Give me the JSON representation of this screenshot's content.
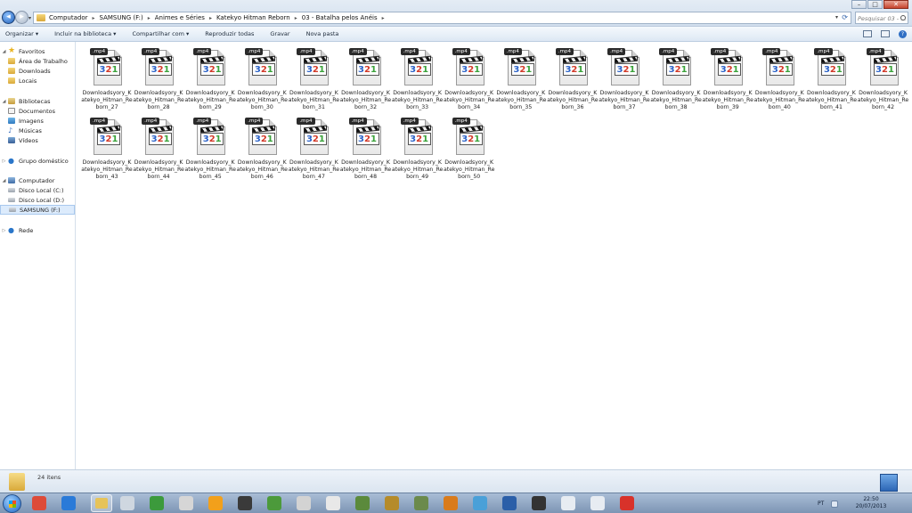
{
  "window": {
    "minimize": "–",
    "maximize": "□",
    "close": "✕"
  },
  "address": {
    "crumbs": [
      "Computador",
      "SAMSUNG (F:)",
      "Animes e Séries",
      "Katekyo Hitman Reborn",
      "03 - Batalha pelos Anéis"
    ],
    "separator": "▸"
  },
  "search": {
    "placeholder": "Pesquisar 03 - ..."
  },
  "toolbar": {
    "items": [
      "Organizar ▾",
      "Incluir na biblioteca ▾",
      "Compartilhar com ▾",
      "Reproduzir todas",
      "Gravar",
      "Nova pasta"
    ]
  },
  "sidebar": {
    "favorites_label": "Favoritos",
    "favorites": [
      "Área de Trabalho",
      "Downloads",
      "Locais"
    ],
    "libraries_label": "Bibliotecas",
    "libraries": [
      "Documentos",
      "Imagens",
      "Músicas",
      "Vídeos"
    ],
    "homegroup_label": "Grupo doméstico",
    "computer_label": "Computador",
    "drives": [
      "Disco Local (C:)",
      "Disco Local (D:)",
      "SAMSUNG (F:)"
    ],
    "network_label": "Rede"
  },
  "files": {
    "ext": ".mp4",
    "badge": [
      "3",
      "2",
      "1"
    ],
    "items": [
      "Downloadsyory_Katekyo_Hitman_Reborn_27",
      "Downloadsyory_Katekyo_Hitman_Reborn_28",
      "Downloadsyory_Katekyo_Hitman_Reborn_29",
      "Downloadsyory_Katekyo_Hitman_Reborn_30",
      "Downloadsyory_Katekyo_Hitman_Reborn_31",
      "Downloadsyory_Katekyo_Hitman_Reborn_32",
      "Downloadsyory_Katekyo_Hitman_Reborn_33",
      "Downloadsyory_Katekyo_Hitman_Reborn_34",
      "Downloadsyory_Katekyo_Hitman_Reborn_35",
      "Downloadsyory_Katekyo_Hitman_Reborn_36",
      "Downloadsyory_Katekyo_Hitman_Reborn_37",
      "Downloadsyory_Katekyo_Hitman_Reborn_38",
      "Downloadsyory_Katekyo_Hitman_Reborn_39",
      "Downloadsyory_Katekyo_Hitman_Reborn_40",
      "Downloadsyory_Katekyo_Hitman_Reborn_41",
      "Downloadsyory_Katekyo_Hitman_Reborn_42",
      "Downloadsyory_Katekyo_Hitman_Reborn_43",
      "Downloadsyory_Katekyo_Hitman_Reborn_44",
      "Downloadsyory_Katekyo_Hitman_Reborn_45",
      "Downloadsyory_Katekyo_Hitman_Reborn_46",
      "Downloadsyory_Katekyo_Hitman_Reborn_47",
      "Downloadsyory_Katekyo_Hitman_Reborn_48",
      "Downloadsyory_Katekyo_Hitman_Reborn_49",
      "Downloadsyory_Katekyo_Hitman_Reborn_50"
    ]
  },
  "status": {
    "count": "24 itens"
  },
  "taskbar": {
    "lang": "PT",
    "time": "22:50",
    "date": "20/07/2013",
    "apps": [
      "chrome-icon",
      "shield-icon",
      "explorer-icon",
      "pen-icon",
      "torrent-icon",
      "gamepad-icon",
      "play-icon",
      "terminal-icon",
      "cube-icon",
      "controller-icon",
      "gamepad2-icon",
      "zombie-icon",
      "league-icon",
      "creature-icon",
      "flame-icon",
      "compass-icon",
      "text-app-icon",
      "warrior-icon",
      "window-icon",
      "monitor-icon",
      "heart-icon"
    ],
    "app_colors": [
      "#dd4b39",
      "#2a7ad8",
      "#e6c35a",
      "#cfd7e0",
      "#3c9a3c",
      "#d6d6d6",
      "#f2a01b",
      "#3a3a3a",
      "#4c9a3b",
      "#d3d3d3",
      "#e8e8e8",
      "#5b8a3c",
      "#b58b2a",
      "#6b8a4c",
      "#d97b1c",
      "#4aa0d8",
      "#2b5fa8",
      "#333333",
      "#e7ecf2",
      "#e7ecf2",
      "#d8322a"
    ]
  }
}
